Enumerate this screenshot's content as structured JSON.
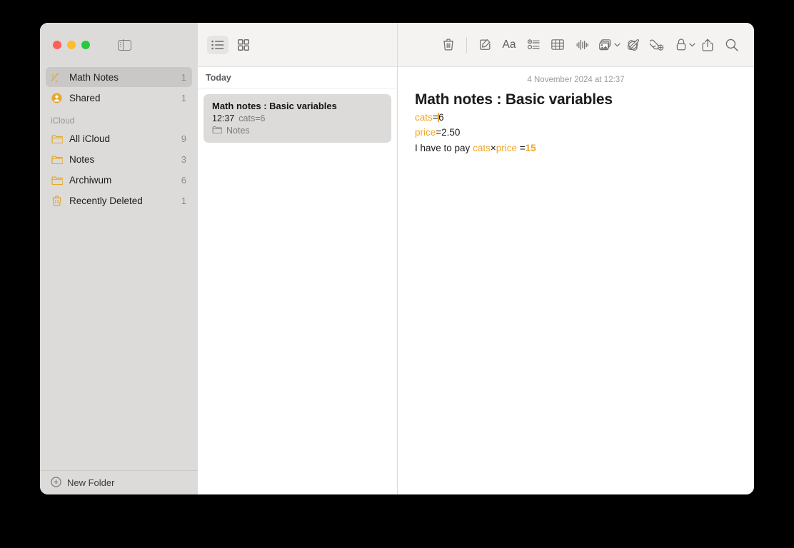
{
  "window": {
    "traffic_lights": [
      "close",
      "minimize",
      "zoom"
    ],
    "colors": {
      "accent_orange": "#f0a62c",
      "sidebar_bg": "#dcdbd9",
      "toolbar_bg": "#f4f3f1",
      "selection": "#c9c8c6"
    }
  },
  "sidebar": {
    "toggle_label": "Toggle Sidebar",
    "top_items": [
      {
        "icon": "math-notes-icon",
        "label": "Math Notes",
        "count": "1",
        "selected": true
      },
      {
        "icon": "shared-person-icon",
        "label": "Shared",
        "count": "1",
        "selected": false
      }
    ],
    "section_header": "iCloud",
    "folders": [
      {
        "icon": "folder-icon",
        "label": "All iCloud",
        "count": "9"
      },
      {
        "icon": "folder-icon",
        "label": "Notes",
        "count": "3"
      },
      {
        "icon": "folder-icon",
        "label": "Archiwum",
        "count": "6"
      },
      {
        "icon": "trash-icon",
        "label": "Recently Deleted",
        "count": "1"
      }
    ],
    "new_folder_label": "New Folder",
    "new_folder_icon": "plus-circle-icon"
  },
  "toolbar": {
    "left": [
      {
        "icon": "list-view-icon",
        "name": "list-view-button",
        "active": true
      },
      {
        "icon": "gallery-view-icon",
        "name": "gallery-view-button",
        "active": false
      }
    ],
    "right": [
      {
        "icon": "trash-icon",
        "name": "delete-note-button"
      },
      {
        "icon": "compose-icon",
        "name": "new-note-button"
      },
      {
        "icon": "format-Aa-icon",
        "name": "format-button",
        "glyph": "Aa"
      },
      {
        "icon": "checklist-icon",
        "name": "checklist-button"
      },
      {
        "icon": "table-icon",
        "name": "table-button"
      },
      {
        "icon": "audio-waveform-icon",
        "name": "record-audio-button"
      },
      {
        "icon": "media-icon",
        "name": "insert-media-button",
        "has_chevron": true
      },
      {
        "icon": "markup-icon",
        "name": "markup-button"
      },
      {
        "icon": "add-link-icon",
        "name": "add-link-button"
      },
      {
        "icon": "lock-icon",
        "name": "lock-note-button",
        "has_chevron": true
      },
      {
        "icon": "share-icon",
        "name": "share-button"
      },
      {
        "icon": "search-icon",
        "name": "search-button"
      }
    ]
  },
  "note_list": {
    "group_header": "Today",
    "notes": [
      {
        "title": "Math notes : Basic variables",
        "time": "12:37",
        "snippet": "cats=6",
        "folder": "Notes",
        "selected": true
      }
    ]
  },
  "detail": {
    "date": "4 November 2024 at 12:37",
    "title": "Math notes : Basic variables",
    "lines": [
      {
        "parts": [
          {
            "t": "cats",
            "k": "var"
          },
          {
            "t": "=",
            "k": "plain"
          },
          {
            "t": "",
            "k": "caret"
          },
          {
            "t": "6",
            "k": "plain"
          }
        ]
      },
      {
        "parts": [
          {
            "t": "price",
            "k": "var"
          },
          {
            "t": "=2.50",
            "k": "plain"
          }
        ]
      },
      {
        "parts": [
          {
            "t": "I have to pay ",
            "k": "plain"
          },
          {
            "t": "cats",
            "k": "var"
          },
          {
            "t": "×",
            "k": "plain"
          },
          {
            "t": "price",
            "k": "var"
          },
          {
            "t": " =",
            "k": "plain"
          },
          {
            "t": "15",
            "k": "res"
          }
        ]
      }
    ]
  }
}
